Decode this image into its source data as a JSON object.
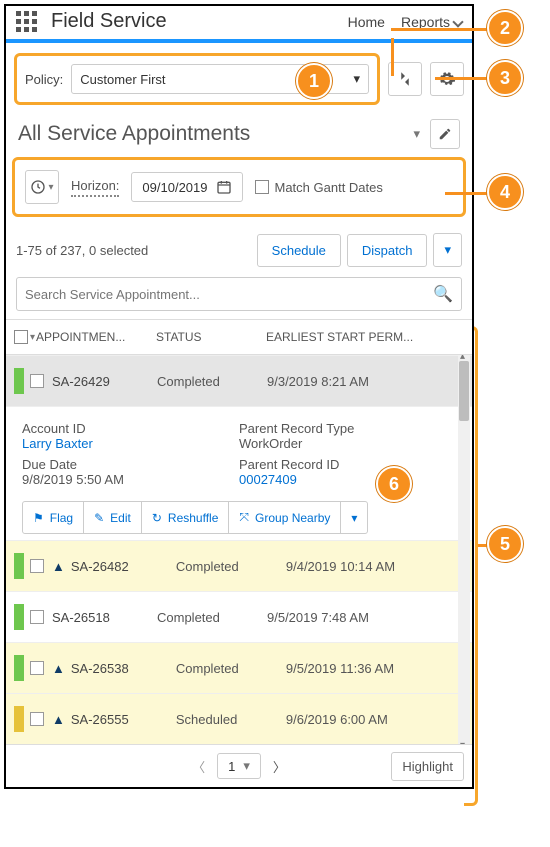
{
  "header": {
    "app": "Field Service",
    "nav_home": "Home",
    "nav_reports": "Reports"
  },
  "policy": {
    "label": "Policy:",
    "value": "Customer First"
  },
  "list_view": {
    "title": "All Service Appointments"
  },
  "horizon": {
    "label": "Horizon:",
    "date": "09/10/2019",
    "match": "Match Gantt Dates"
  },
  "counts": {
    "text": "1-75 of 237, 0 selected",
    "schedule": "Schedule",
    "dispatch": "Dispatch"
  },
  "search": {
    "placeholder": "Search Service Appointment..."
  },
  "cols": {
    "appt": "APPOINTMEN...",
    "status": "STATUS",
    "start": "EARLIEST START PERM..."
  },
  "rows": [
    {
      "id": "SA-26429",
      "status": "Completed",
      "start": "9/3/2019 8:21 AM",
      "warn": false,
      "sel": true,
      "bg": "sel",
      "mark": "green"
    },
    {
      "id": "SA-26482",
      "status": "Completed",
      "start": "9/4/2019 10:14 AM",
      "warn": true,
      "sel": false,
      "bg": "yellow",
      "mark": "green"
    },
    {
      "id": "SA-26518",
      "status": "Completed",
      "start": "9/5/2019 7:48 AM",
      "warn": false,
      "sel": false,
      "bg": "",
      "mark": "green"
    },
    {
      "id": "SA-26538",
      "status": "Completed",
      "start": "9/5/2019 11:36 AM",
      "warn": true,
      "sel": false,
      "bg": "yellow",
      "mark": "green"
    },
    {
      "id": "SA-26555",
      "status": "Scheduled",
      "start": "9/6/2019 6:00 AM",
      "warn": true,
      "sel": false,
      "bg": "yellow",
      "mark": "gold"
    }
  ],
  "detail": {
    "account_label": "Account ID",
    "account_val": "Larry Baxter",
    "ptype_label": "Parent Record Type",
    "ptype_val": "WorkOrder",
    "due_label": "Due Date",
    "due_val": "9/8/2019 5:50 AM",
    "pid_label": "Parent Record ID",
    "pid_val": "00027409",
    "flag": "Flag",
    "edit": "Edit",
    "reshuffle": "Reshuffle",
    "group": "Group Nearby"
  },
  "pager": {
    "current": "1"
  },
  "highlight": "Highlight",
  "callouts": {
    "c1": "1",
    "c2": "2",
    "c3": "3",
    "c4": "4",
    "c5": "5",
    "c6": "6"
  }
}
